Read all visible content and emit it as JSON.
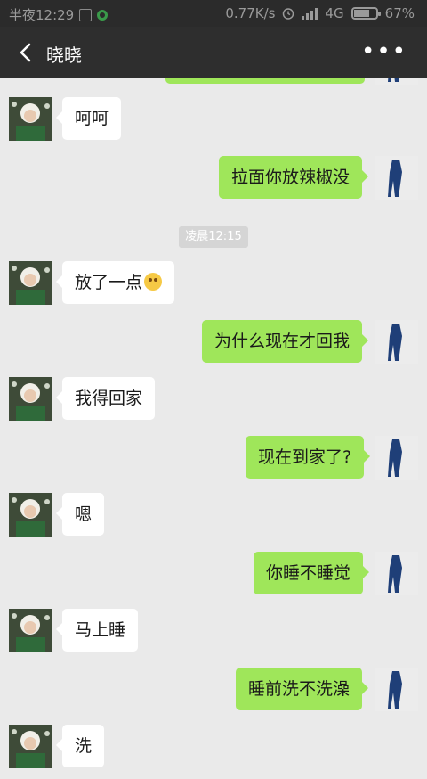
{
  "status_bar": {
    "time": "半夜12:29",
    "speed": "0.77K/s",
    "network": "4G",
    "battery": "67%",
    "battery_level": 0.67
  },
  "header": {
    "title": "晓晓",
    "back_icon": "chevron-left-icon",
    "more_icon": "more-icon"
  },
  "messages": [
    {
      "side": "left",
      "text": "呵呵"
    },
    {
      "side": "right",
      "text": "拉面你放辣椒没"
    },
    {
      "side": "time",
      "text": "凌晨12:15"
    },
    {
      "side": "left",
      "text": "放了一点"
    },
    {
      "side": "right",
      "text": "为什么现在才回我"
    },
    {
      "side": "left",
      "text": "我得回家"
    },
    {
      "side": "right",
      "text": "现在到家了?"
    },
    {
      "side": "left",
      "text": "嗯"
    },
    {
      "side": "right",
      "text": "你睡不睡觉"
    },
    {
      "side": "left",
      "text": "马上睡"
    },
    {
      "side": "right",
      "text": "睡前洗不洗澡"
    },
    {
      "side": "left",
      "text": "洗"
    }
  ],
  "colors": {
    "header_bg": "#2e2e2e",
    "chat_bg": "#eaeaea",
    "self_bubble": "#9fe65a",
    "other_bubble": "#ffffff"
  }
}
